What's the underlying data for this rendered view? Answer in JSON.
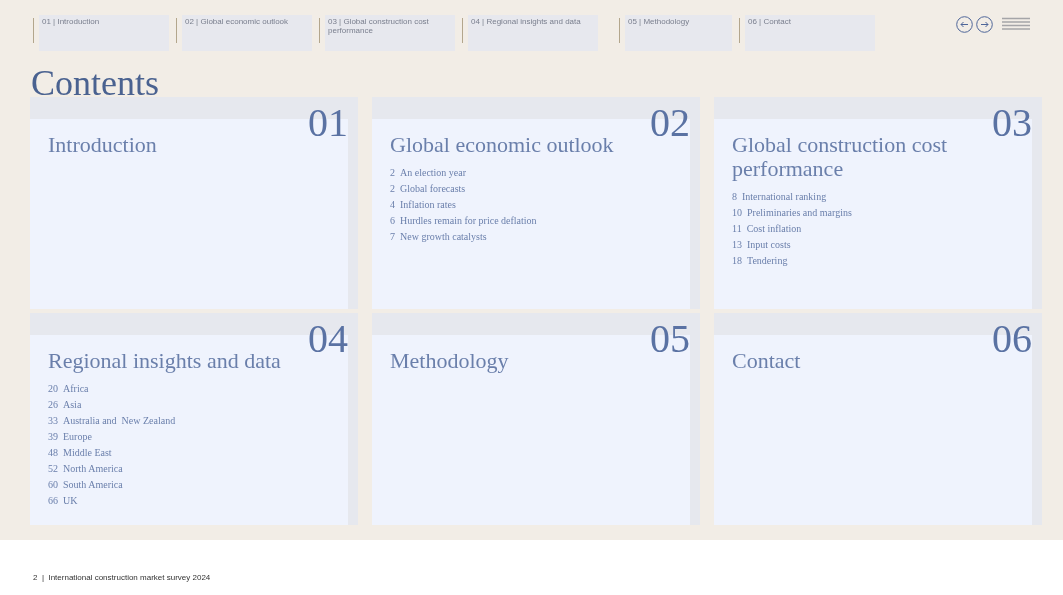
{
  "nav_tabs": [
    {
      "label": "01 | Introduction"
    },
    {
      "label": "02 | Global economic outlook"
    },
    {
      "label": "03 | Global construction cost performance"
    },
    {
      "label": "04 | Regional insights and data"
    },
    {
      "label": "05 | Methodology"
    },
    {
      "label": "06 | Contact"
    }
  ],
  "title": "Contents",
  "sections": [
    {
      "number": "01",
      "title": "Introduction"
    },
    {
      "number": "02",
      "title": "Global economic outlook",
      "items": [
        {
          "page": "2",
          "label": "An election year"
        },
        {
          "page": "2",
          "label": "Global forecasts"
        },
        {
          "page": "4",
          "label": "Inflation rates"
        },
        {
          "page": "6",
          "label": "Hurdles remain for price deflation"
        },
        {
          "page": "7",
          "label": "New growth catalysts"
        }
      ]
    },
    {
      "number": "03",
      "title": "Global construction cost performance",
      "items": [
        {
          "page": "8",
          "label": "International ranking"
        },
        {
          "page": "10",
          "label": "Preliminaries and margins"
        },
        {
          "page": "11",
          "label": "Cost inflation"
        },
        {
          "page": "13",
          "label": "Input costs"
        },
        {
          "page": "18",
          "label": "Tendering"
        }
      ]
    },
    {
      "number": "04",
      "title": "Regional insights and data",
      "items": [
        {
          "page": "20",
          "label": "Africa"
        },
        {
          "page": "26",
          "label": "Asia"
        },
        {
          "page": "33",
          "label": "Australia and  New Zealand"
        },
        {
          "page": "39",
          "label": "Europe"
        },
        {
          "page": "48",
          "label": "Middle East"
        },
        {
          "page": "52",
          "label": "North America"
        },
        {
          "page": "60",
          "label": "South America"
        },
        {
          "page": "66",
          "label": "UK"
        }
      ]
    },
    {
      "number": "05",
      "title": "Methodology"
    },
    {
      "number": "06",
      "title": "Contact"
    }
  ],
  "footer": "2  |  International construction market survey 2024"
}
